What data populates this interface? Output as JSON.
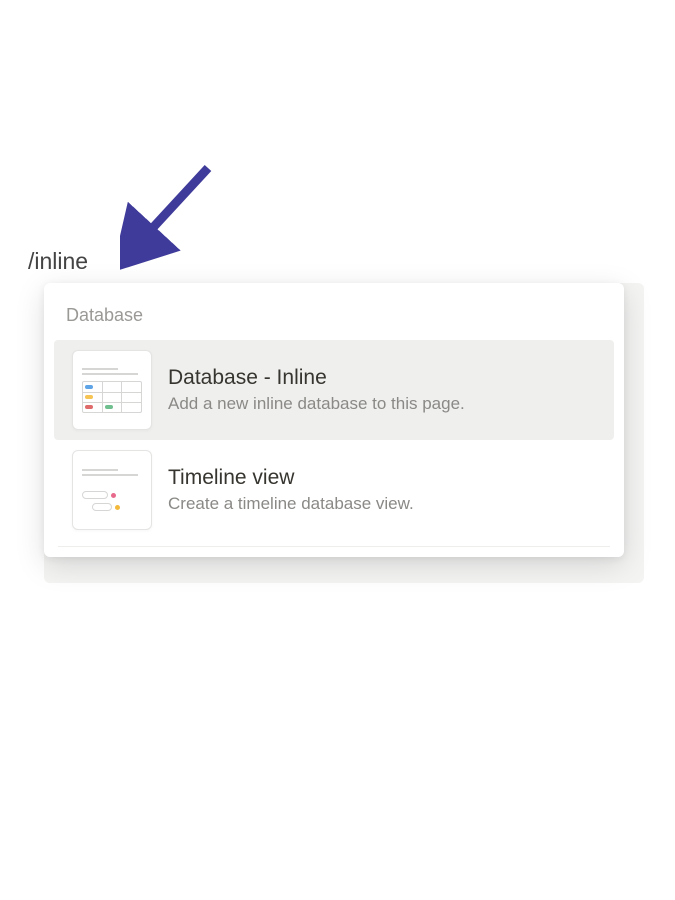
{
  "command_input": "/inline",
  "section_label": "Database",
  "menu_items": [
    {
      "title": "Database - Inline",
      "description": "Add a new inline database to this page.",
      "selected": true,
      "thumb": "database"
    },
    {
      "title": "Timeline view",
      "description": "Create a timeline database view.",
      "selected": false,
      "thumb": "timeline"
    }
  ],
  "colors": {
    "arrow": "#3f3b9a",
    "chip_blue": "#5fa4e6",
    "chip_yellow": "#f6c453",
    "chip_red": "#e06b6b",
    "chip_green": "#6fbf8f",
    "dot_pink": "#e76a8c",
    "dot_yellow": "#f3b93c"
  }
}
